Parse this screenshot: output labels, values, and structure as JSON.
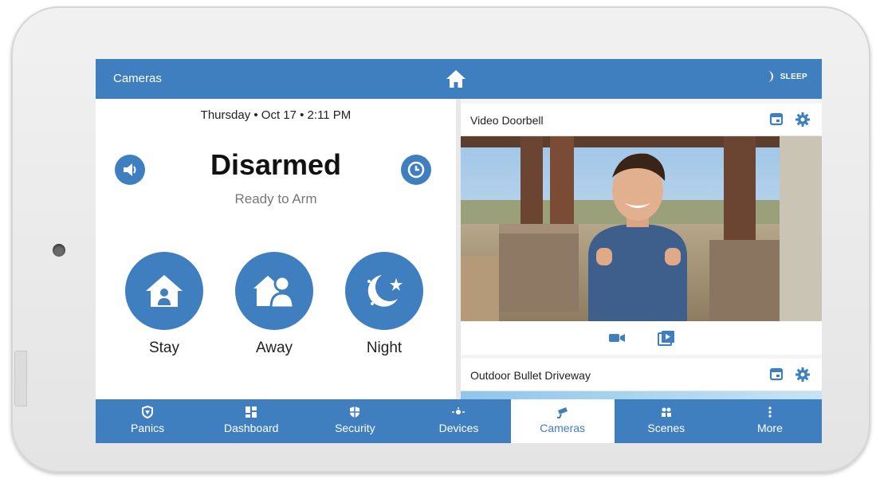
{
  "header": {
    "title": "Cameras",
    "home_icon": "home-icon",
    "sleep_label": "SLEEP",
    "sleep_icon": "moon-icon"
  },
  "status": {
    "datetime": "Thursday • Oct 17 • 2:11 PM",
    "state": "Disarmed",
    "substate": "Ready to Arm",
    "volume_icon": "speaker-icon",
    "clock_icon": "clock-icon"
  },
  "arm_buttons": [
    {
      "label": "Stay",
      "icon": "house-person-icon"
    },
    {
      "label": "Away",
      "icon": "person-leaving-icon"
    },
    {
      "label": "Night",
      "icon": "moon-star-icon"
    }
  ],
  "cameras": [
    {
      "name": "Video Doorbell",
      "calendar_icon": "calendar-icon",
      "settings_icon": "gear-icon",
      "controls": [
        "video-camera-icon",
        "playback-icon"
      ]
    },
    {
      "name": "Outdoor Bullet Driveway",
      "calendar_icon": "calendar-icon",
      "settings_icon": "gear-icon"
    }
  ],
  "nav": [
    {
      "label": "Panics",
      "icon": "shield-alert-icon"
    },
    {
      "label": "Dashboard",
      "icon": "dashboard-icon"
    },
    {
      "label": "Security",
      "icon": "security-shield-icon"
    },
    {
      "label": "Devices",
      "icon": "devices-icon"
    },
    {
      "label": "Cameras",
      "icon": "camera-icon",
      "active": true
    },
    {
      "label": "Scenes",
      "icon": "scenes-icon"
    },
    {
      "label": "More",
      "icon": "more-vertical-icon"
    }
  ],
  "colors": {
    "accent": "#3f7fc0",
    "panel_bg": "#ffffff",
    "bezel": "#e8e8e8"
  }
}
